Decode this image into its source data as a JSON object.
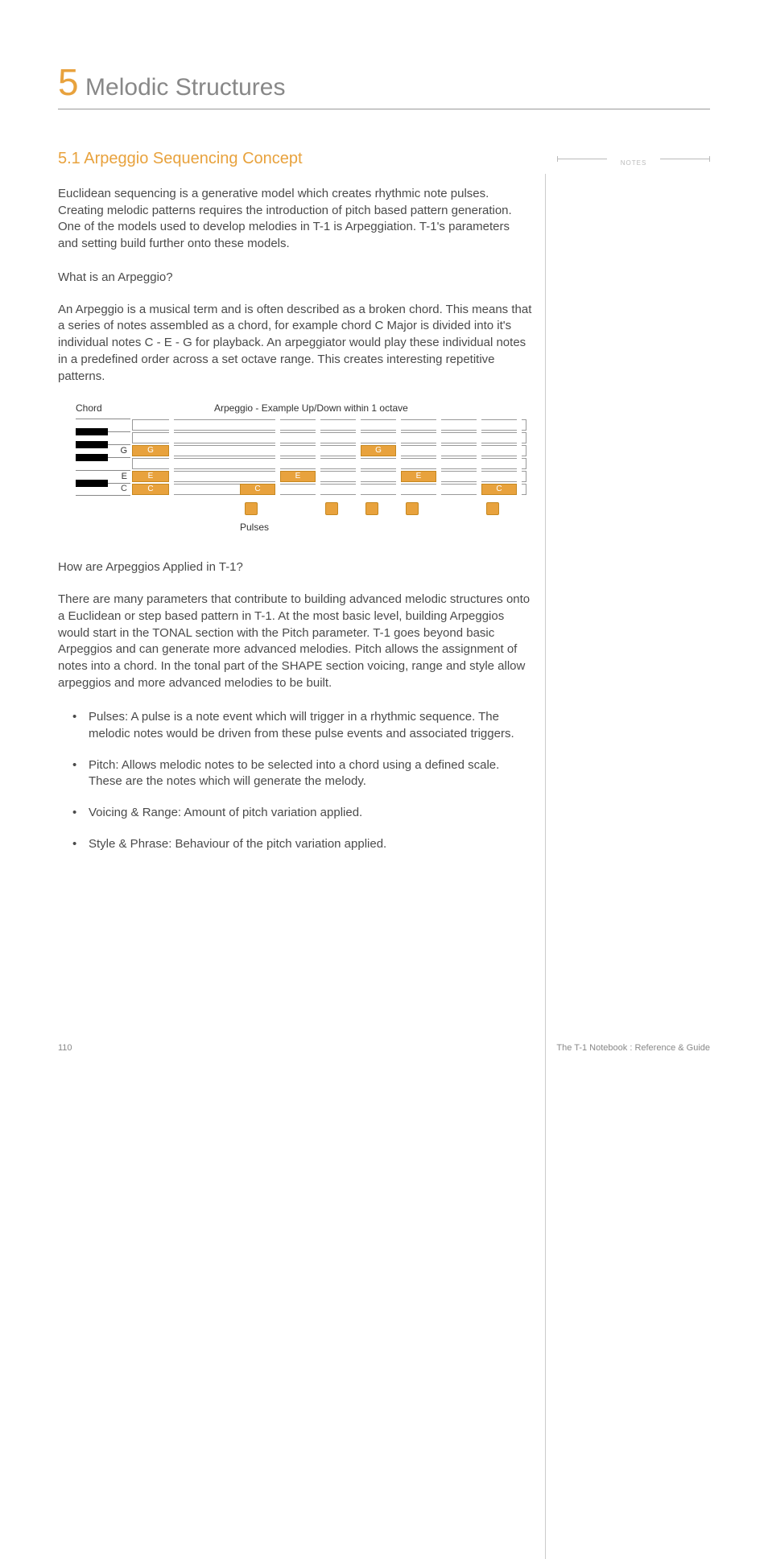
{
  "chapter": {
    "number": "5",
    "title": "Melodic Structures"
  },
  "section": {
    "title": "5.1 Arpeggio Sequencing Concept"
  },
  "para1": "Euclidean sequencing is a generative model which creates rhythmic note pulses. Creating melodic patterns requires the introduction of pitch based pattern generation. One of the models used to develop melodies in T-1 is Arpeggiation. T-1's parameters and setting build further onto these models.",
  "sub1": "What is an Arpeggio?",
  "para2": "An Arpeggio is a musical term and is often described as a broken chord. This means that a series of notes assembled as a chord, for example chord C Major is divided into it's individual notes C - E - G for playback. An arpeggiator would play these individual notes in a predefined order across a set octave range. This creates interesting repetitive patterns.",
  "diagram": {
    "chord_label": "Chord",
    "arp_label": "Arpeggio - Example Up/Down within 1 octave",
    "pulses_label": "Pulses",
    "rows": [
      {
        "note": "G",
        "chord_on": true,
        "positions": [
          2
        ]
      },
      {
        "note": "E",
        "chord_on": true,
        "positions": [
          1,
          3
        ]
      },
      {
        "note": "C",
        "chord_on": true,
        "positions": [
          0,
          4
        ]
      }
    ],
    "pulse_positions": [
      0,
      1,
      2,
      3,
      4
    ],
    "notes_G": "G",
    "notes_E": "E",
    "notes_C": "C"
  },
  "sub2": "How are Arpeggios Applied in T-1?",
  "para3": "There are many parameters that contribute to building advanced melodic structures onto a Euclidean or step based pattern in T-1. At the most basic level, building Arpeggios would start in the TONAL section with the Pitch parameter. T-1 goes beyond basic Arpeggios and can generate more advanced melodies. Pitch allows the assignment of notes into a chord. In the tonal part of the SHAPE section voicing, range and style allow arpeggios and more advanced melodies to be built.",
  "bullets": [
    "Pulses: A pulse is a note event which will trigger in a rhythmic sequence. The melodic notes would be driven from these pulse events and associated triggers.",
    "Pitch: Allows melodic notes to be selected into a chord using a defined scale. These are the notes which will generate the melody.",
    "Voicing & Range: Amount of pitch variation applied.",
    "Style & Phrase: Behaviour of the pitch variation applied."
  ],
  "notes_header": "NOTES",
  "footer": {
    "page": "110",
    "book": "The T-1 Notebook : Reference & Guide"
  }
}
